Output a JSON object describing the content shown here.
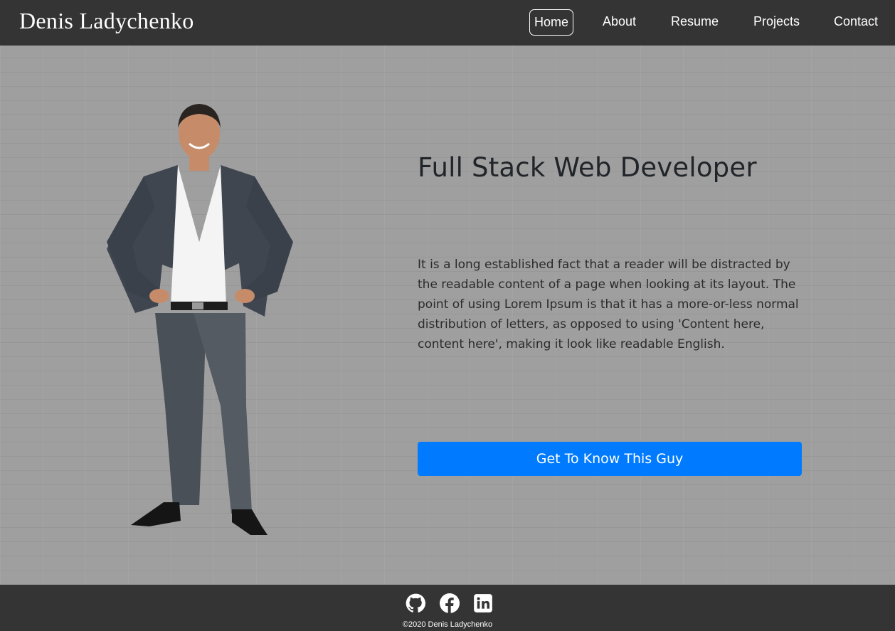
{
  "header": {
    "brand": "Denis Ladychenko",
    "nav": [
      {
        "label": "Home",
        "active": true
      },
      {
        "label": "About"
      },
      {
        "label": "Resume"
      },
      {
        "label": "Projects"
      },
      {
        "label": "Contact"
      }
    ]
  },
  "hero": {
    "headline": "Full Stack Web Developer",
    "paragraph": "It is a long established fact that a reader will be distracted by the readable content of a page when looking at its layout. The point of using Lorem Ipsum is that it has a more-or-less normal distribution of letters, as opposed to using 'Content here, content here', making it look like readable English.",
    "button_label": "Get To Know This Guy",
    "button_color": "#007bff"
  },
  "footer": {
    "social_icons": [
      "github-icon",
      "facebook-icon",
      "linkedin-icon"
    ],
    "copyright": "©2020 Denis Ladychenko"
  },
  "colors": {
    "navbar_bg": "#343434",
    "page_bg": "#9f9f9f",
    "text_dark": "#212529"
  }
}
